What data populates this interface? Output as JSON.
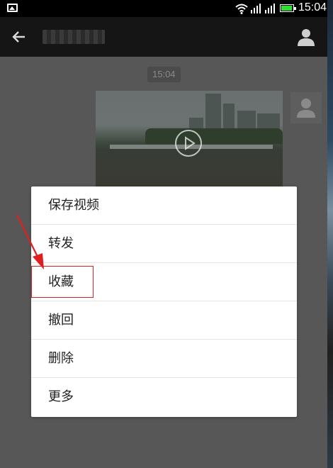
{
  "status_bar": {
    "time": "15:04"
  },
  "chat": {
    "timestamp": "15:04"
  },
  "menu": {
    "items": [
      {
        "label": "保存视频"
      },
      {
        "label": "转发"
      },
      {
        "label": "收藏"
      },
      {
        "label": "撤回"
      },
      {
        "label": "删除"
      },
      {
        "label": "更多"
      }
    ]
  },
  "colors": {
    "annotation": "#e02020",
    "battery": "#2ee02e",
    "nav_background": "#151515"
  },
  "icons": [
    "image-icon",
    "wifi-icon",
    "signal-icon",
    "battery-icon",
    "back-arrow-icon",
    "profile-icon",
    "play-icon",
    "avatar-icon"
  ]
}
